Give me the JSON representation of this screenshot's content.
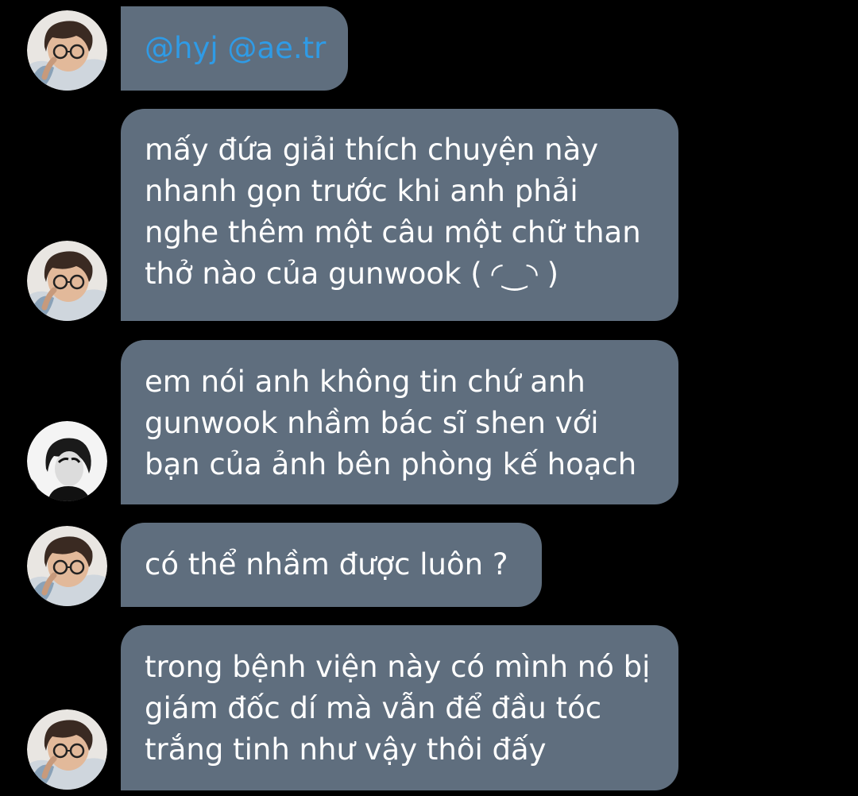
{
  "colors": {
    "background": "#000000",
    "bubble": "#5f6e7e",
    "message_text": "#ffffff",
    "mention": "#2f9be6"
  },
  "messages": [
    {
      "sender_avatar": "boy-with-glasses-photo",
      "mentions": [
        "@hyj",
        "@ae.tr"
      ]
    },
    {
      "sender_avatar": "boy-with-glasses-photo",
      "lines": [
        "mấy đứa giải thích chuyện này",
        "nhanh gọn trước khi anh phải",
        "nghe thêm một câu một chữ than",
        "thở nào của gunwook ( ◜‿◝ )"
      ]
    },
    {
      "sender_avatar": "black-and-white-portrait",
      "lines": [
        "em nói anh không tin chứ anh",
        "gunwook nhầm bác sĩ shen với",
        "bạn của ảnh bên phòng kế hoạch"
      ]
    },
    {
      "sender_avatar": "boy-with-glasses-photo",
      "lines": [
        "có thể nhầm được luôn ?"
      ]
    },
    {
      "sender_avatar": "boy-with-glasses-photo",
      "lines": [
        "trong bệnh viện này có mình nó bị",
        "giám đốc dí mà vẫn để đầu tóc",
        "trắng tinh như vậy thôi đấy"
      ]
    }
  ]
}
